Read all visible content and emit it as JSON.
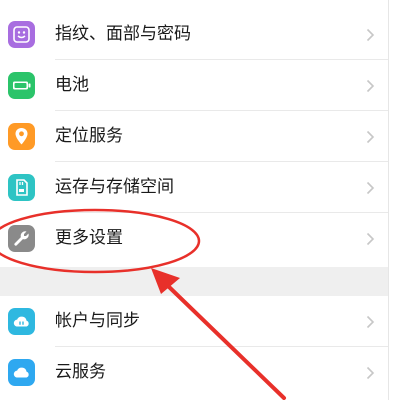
{
  "settings": {
    "group1": [
      {
        "label": "指纹、面部与密码",
        "icon": "fingerprint-face-icon",
        "color": "#a86de0"
      },
      {
        "label": "电池",
        "icon": "battery-icon",
        "color": "#2bc46a"
      },
      {
        "label": "定位服务",
        "icon": "location-pin-icon",
        "color": "#ff9a26"
      },
      {
        "label": "运存与存储空间",
        "icon": "storage-sd-icon",
        "color": "#2ec4c4"
      },
      {
        "label": "更多设置",
        "icon": "wrench-icon",
        "color": "#8a8a8a"
      }
    ],
    "group2": [
      {
        "label": "帐户与同步",
        "icon": "account-sync-icon",
        "color": "#2eb8e0"
      },
      {
        "label": "云服务",
        "icon": "cloud-icon",
        "color": "#2ea8f0"
      }
    ]
  },
  "annotation": {
    "color": "#e8302a",
    "target": "更多设置"
  }
}
